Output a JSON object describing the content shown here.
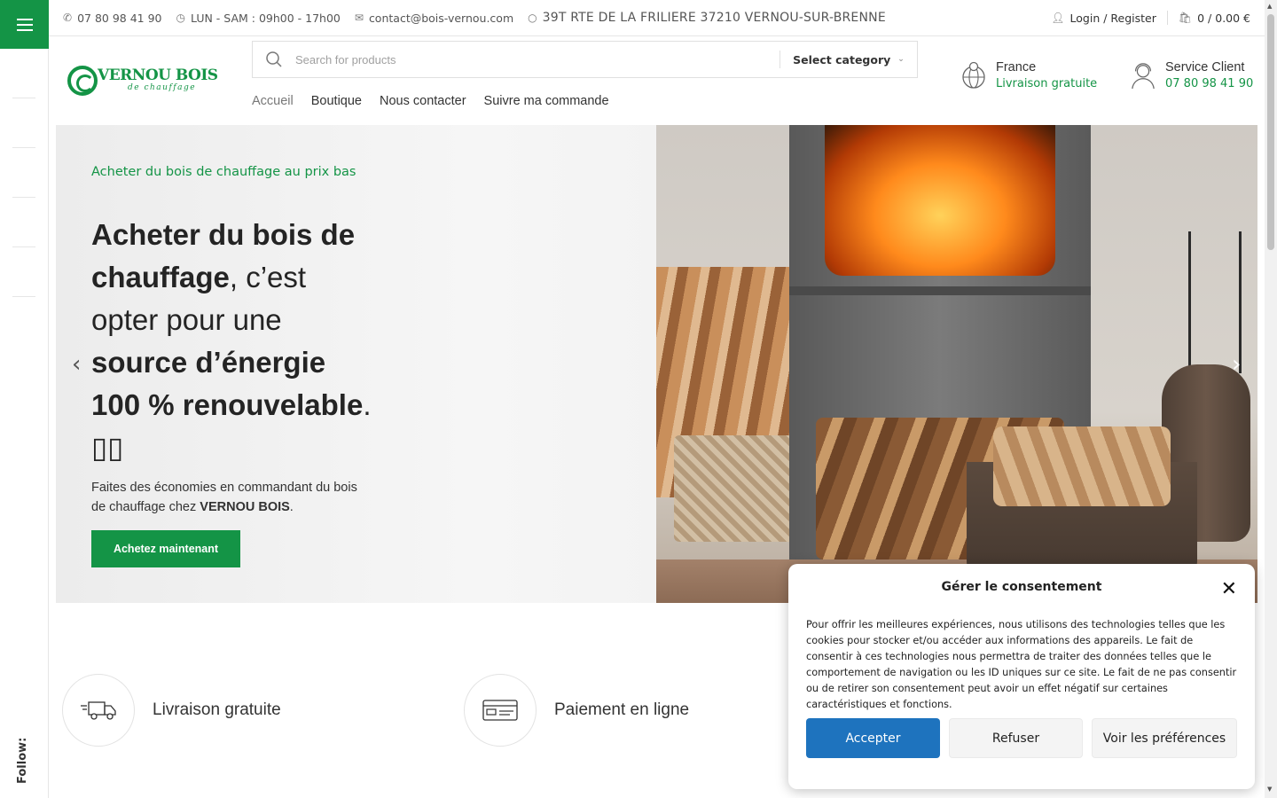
{
  "topbar": {
    "phone": "07 80 98 41 90",
    "hours": "LUN - SAM : 09h00 - 17h00",
    "email": "contact@bois-vernou.com",
    "address": "39T RTE DE LA FRILIERE 37210 VERNOU-SUR-BRENNE",
    "login_label": "Login / Register",
    "cart_label": "0 / 0.00 €"
  },
  "logo": {
    "title": "VERNOU BOIS",
    "subtitle": "de chauffage"
  },
  "search": {
    "placeholder": "Search for products",
    "category_label": "Select category"
  },
  "nav": {
    "items": [
      "Accueil",
      "Boutique",
      "Nous contacter",
      "Suivre ma commande"
    ]
  },
  "info": {
    "shipping_title": "France",
    "shipping_sub": "Livraison gratuite",
    "support_title": "Service Client",
    "support_sub": "07 80 98 41 90"
  },
  "hero": {
    "subtitle": "Acheter du bois de chauffage au prix bas",
    "title_bold_1": "Acheter du bois de chauffage",
    "title_normal_1": ", c’est opter pour une ",
    "title_bold_2": "source d’énergie 100 % renouvelable",
    "title_tail": ". ",
    "desc_text": "Faites des économies en commandant du bois de chauffage chez ",
    "desc_brand": "VERNOU BOIS",
    "desc_end": ".",
    "button_label": "Achetez maintenant"
  },
  "features": [
    {
      "label": "Livraison gratuite",
      "icon": "truck-icon"
    },
    {
      "label": "Paiement en ligne",
      "icon": "credit-card-icon"
    }
  ],
  "sidebar": {
    "follow_label": "Follow:"
  },
  "consent": {
    "title": "Gérer le consentement",
    "text": "Pour offrir les meilleures expériences, nous utilisons des technologies telles que les cookies pour stocker et/ou accéder aux informations des appareils. Le fait de consentir à ces technologies nous permettra de traiter des données telles que le comportement de navigation ou les ID uniques sur ce site. Le fait de ne pas consentir ou de retirer son consentement peut avoir un effet négatif sur certaines caractéristiques et fonctions.",
    "accept_label": "Accepter",
    "refuse_label": "Refuser",
    "prefs_label": "Voir les préférences"
  },
  "colors": {
    "brand_green": "#149446",
    "consent_blue": "#1e73be"
  }
}
